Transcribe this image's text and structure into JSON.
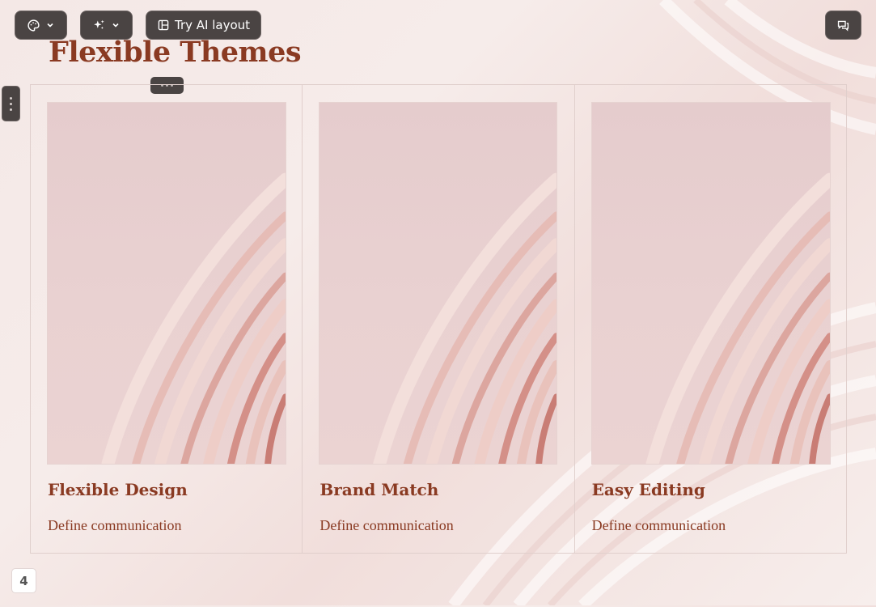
{
  "toolbar": {
    "theme_icon": "palette-icon",
    "ai_icon": "sparkles-icon",
    "chevron_icon": "chevron-down-icon",
    "layout_icon": "layout-icon",
    "try_ai_layout_label": "Try AI layout",
    "comments_icon": "comments-icon"
  },
  "slide": {
    "title": "Flexible Themes",
    "page_number": "4",
    "cards": [
      {
        "title": "Flexible Design",
        "description": "Define communication"
      },
      {
        "title": "Brand Match",
        "description": "Define communication"
      },
      {
        "title": "Easy Editing",
        "description": "Define communication"
      }
    ]
  },
  "colors": {
    "accent": "#8a3a22",
    "toolbar_bg": "#4a4443",
    "background": "#f4e8e6"
  }
}
